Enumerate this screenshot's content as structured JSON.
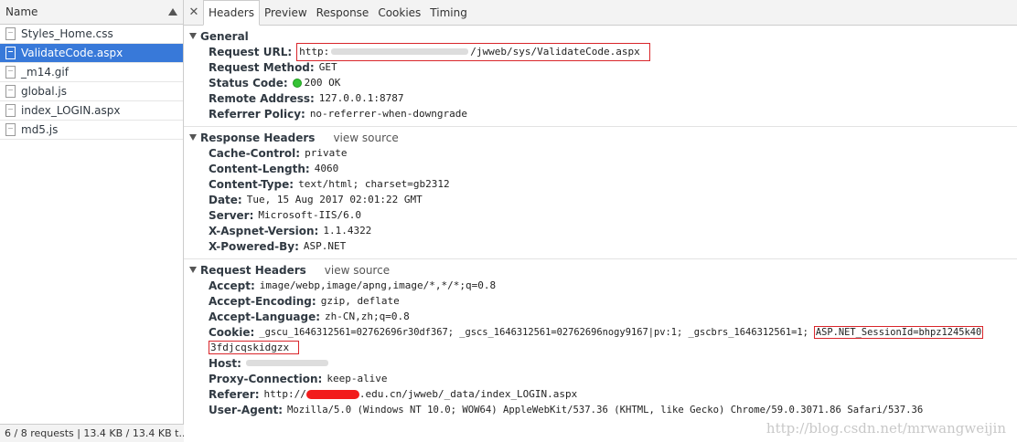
{
  "left_panel": {
    "header_label": "Name",
    "files": [
      {
        "name": "Styles_Home.css",
        "selected": false
      },
      {
        "name": "ValidateCode.aspx",
        "selected": true
      },
      {
        "name": "_m14.gif",
        "selected": false
      },
      {
        "name": "global.js",
        "selected": false
      },
      {
        "name": "index_LOGIN.aspx",
        "selected": false
      },
      {
        "name": "md5.js",
        "selected": false
      }
    ],
    "status": "6 / 8 requests  |  13.4 KB / 13.4 KB t..."
  },
  "tabs": [
    "Headers",
    "Preview",
    "Response",
    "Cookies",
    "Timing"
  ],
  "active_tab": "Headers",
  "general": {
    "title": "General",
    "request_url_key": "Request URL:",
    "request_url_prefix": "http:",
    "request_url_suffix": "/jwweb/sys/ValidateCode.aspx",
    "request_method_key": "Request Method:",
    "request_method": "GET",
    "status_code_key": "Status Code:",
    "status_code": "200 OK",
    "remote_address_key": "Remote Address:",
    "remote_address": "127.0.0.1:8787",
    "referrer_policy_key": "Referrer Policy:",
    "referrer_policy": "no-referrer-when-downgrade"
  },
  "response_headers": {
    "title": "Response Headers",
    "view_source": "view source",
    "items": [
      {
        "k": "Cache-Control:",
        "v": "private"
      },
      {
        "k": "Content-Length:",
        "v": "4060"
      },
      {
        "k": "Content-Type:",
        "v": "text/html; charset=gb2312"
      },
      {
        "k": "Date:",
        "v": "Tue, 15 Aug 2017 02:01:22 GMT"
      },
      {
        "k": "Server:",
        "v": "Microsoft-IIS/6.0"
      },
      {
        "k": "X-Aspnet-Version:",
        "v": "1.1.4322"
      },
      {
        "k": "X-Powered-By:",
        "v": "ASP.NET"
      }
    ]
  },
  "request_headers": {
    "title": "Request Headers",
    "view_source": "view source",
    "accept_k": "Accept:",
    "accept_v": "image/webp,image/apng,image/*,*/*;q=0.8",
    "accept_encoding_k": "Accept-Encoding:",
    "accept_encoding_v": "gzip, deflate",
    "accept_language_k": "Accept-Language:",
    "accept_language_v": "zh-CN,zh;q=0.8",
    "cookie_k": "Cookie:",
    "cookie_v": "_gscu_1646312561=02762696r30df367; _gscs_1646312561=02762696nogy9167|pv:1; _gscbrs_1646312561=1;",
    "cookie_session_a": "ASP.NET_SessionId=bhpz1245k40",
    "cookie_session_b": "3fdjcqskidgzx",
    "host_k": "Host:",
    "proxy_k": "Proxy-Connection:",
    "proxy_v": "keep-alive",
    "referer_k": "Referer:",
    "referer_prefix": "http://",
    "referer_suffix": ".edu.cn/jwweb/_data/index_LOGIN.aspx",
    "ua_k": "User-Agent:",
    "ua_v": "Mozilla/5.0 (Windows NT 10.0; WOW64) AppleWebKit/537.36 (KHTML, like Gecko) Chrome/59.0.3071.86 Safari/537.36"
  },
  "watermark": "http://blog.csdn.net/mrwangweijin"
}
